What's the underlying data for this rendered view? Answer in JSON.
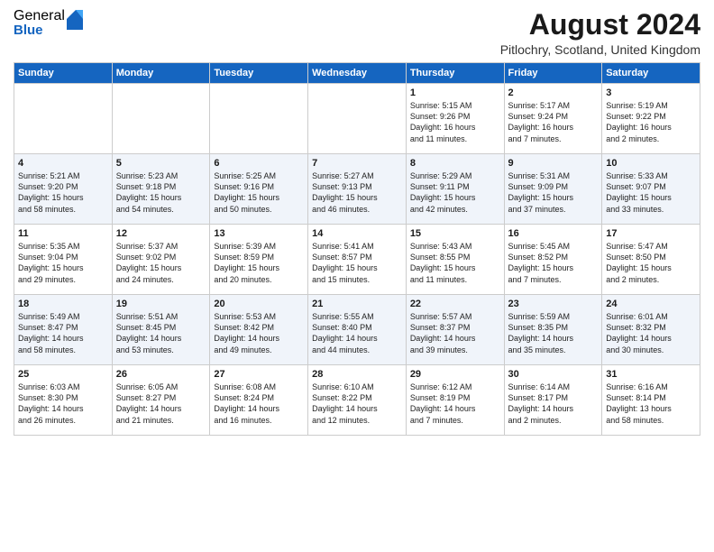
{
  "header": {
    "logo_general": "General",
    "logo_blue": "Blue",
    "month_title": "August 2024",
    "location": "Pitlochry, Scotland, United Kingdom"
  },
  "days_of_week": [
    "Sunday",
    "Monday",
    "Tuesday",
    "Wednesday",
    "Thursday",
    "Friday",
    "Saturday"
  ],
  "weeks": [
    [
      {
        "day": "",
        "info": ""
      },
      {
        "day": "",
        "info": ""
      },
      {
        "day": "",
        "info": ""
      },
      {
        "day": "",
        "info": ""
      },
      {
        "day": "1",
        "info": "Sunrise: 5:15 AM\nSunset: 9:26 PM\nDaylight: 16 hours\nand 11 minutes."
      },
      {
        "day": "2",
        "info": "Sunrise: 5:17 AM\nSunset: 9:24 PM\nDaylight: 16 hours\nand 7 minutes."
      },
      {
        "day": "3",
        "info": "Sunrise: 5:19 AM\nSunset: 9:22 PM\nDaylight: 16 hours\nand 2 minutes."
      }
    ],
    [
      {
        "day": "4",
        "info": "Sunrise: 5:21 AM\nSunset: 9:20 PM\nDaylight: 15 hours\nand 58 minutes."
      },
      {
        "day": "5",
        "info": "Sunrise: 5:23 AM\nSunset: 9:18 PM\nDaylight: 15 hours\nand 54 minutes."
      },
      {
        "day": "6",
        "info": "Sunrise: 5:25 AM\nSunset: 9:16 PM\nDaylight: 15 hours\nand 50 minutes."
      },
      {
        "day": "7",
        "info": "Sunrise: 5:27 AM\nSunset: 9:13 PM\nDaylight: 15 hours\nand 46 minutes."
      },
      {
        "day": "8",
        "info": "Sunrise: 5:29 AM\nSunset: 9:11 PM\nDaylight: 15 hours\nand 42 minutes."
      },
      {
        "day": "9",
        "info": "Sunrise: 5:31 AM\nSunset: 9:09 PM\nDaylight: 15 hours\nand 37 minutes."
      },
      {
        "day": "10",
        "info": "Sunrise: 5:33 AM\nSunset: 9:07 PM\nDaylight: 15 hours\nand 33 minutes."
      }
    ],
    [
      {
        "day": "11",
        "info": "Sunrise: 5:35 AM\nSunset: 9:04 PM\nDaylight: 15 hours\nand 29 minutes."
      },
      {
        "day": "12",
        "info": "Sunrise: 5:37 AM\nSunset: 9:02 PM\nDaylight: 15 hours\nand 24 minutes."
      },
      {
        "day": "13",
        "info": "Sunrise: 5:39 AM\nSunset: 8:59 PM\nDaylight: 15 hours\nand 20 minutes."
      },
      {
        "day": "14",
        "info": "Sunrise: 5:41 AM\nSunset: 8:57 PM\nDaylight: 15 hours\nand 15 minutes."
      },
      {
        "day": "15",
        "info": "Sunrise: 5:43 AM\nSunset: 8:55 PM\nDaylight: 15 hours\nand 11 minutes."
      },
      {
        "day": "16",
        "info": "Sunrise: 5:45 AM\nSunset: 8:52 PM\nDaylight: 15 hours\nand 7 minutes."
      },
      {
        "day": "17",
        "info": "Sunrise: 5:47 AM\nSunset: 8:50 PM\nDaylight: 15 hours\nand 2 minutes."
      }
    ],
    [
      {
        "day": "18",
        "info": "Sunrise: 5:49 AM\nSunset: 8:47 PM\nDaylight: 14 hours\nand 58 minutes."
      },
      {
        "day": "19",
        "info": "Sunrise: 5:51 AM\nSunset: 8:45 PM\nDaylight: 14 hours\nand 53 minutes."
      },
      {
        "day": "20",
        "info": "Sunrise: 5:53 AM\nSunset: 8:42 PM\nDaylight: 14 hours\nand 49 minutes."
      },
      {
        "day": "21",
        "info": "Sunrise: 5:55 AM\nSunset: 8:40 PM\nDaylight: 14 hours\nand 44 minutes."
      },
      {
        "day": "22",
        "info": "Sunrise: 5:57 AM\nSunset: 8:37 PM\nDaylight: 14 hours\nand 39 minutes."
      },
      {
        "day": "23",
        "info": "Sunrise: 5:59 AM\nSunset: 8:35 PM\nDaylight: 14 hours\nand 35 minutes."
      },
      {
        "day": "24",
        "info": "Sunrise: 6:01 AM\nSunset: 8:32 PM\nDaylight: 14 hours\nand 30 minutes."
      }
    ],
    [
      {
        "day": "25",
        "info": "Sunrise: 6:03 AM\nSunset: 8:30 PM\nDaylight: 14 hours\nand 26 minutes."
      },
      {
        "day": "26",
        "info": "Sunrise: 6:05 AM\nSunset: 8:27 PM\nDaylight: 14 hours\nand 21 minutes."
      },
      {
        "day": "27",
        "info": "Sunrise: 6:08 AM\nSunset: 8:24 PM\nDaylight: 14 hours\nand 16 minutes."
      },
      {
        "day": "28",
        "info": "Sunrise: 6:10 AM\nSunset: 8:22 PM\nDaylight: 14 hours\nand 12 minutes."
      },
      {
        "day": "29",
        "info": "Sunrise: 6:12 AM\nSunset: 8:19 PM\nDaylight: 14 hours\nand 7 minutes."
      },
      {
        "day": "30",
        "info": "Sunrise: 6:14 AM\nSunset: 8:17 PM\nDaylight: 14 hours\nand 2 minutes."
      },
      {
        "day": "31",
        "info": "Sunrise: 6:16 AM\nSunset: 8:14 PM\nDaylight: 13 hours\nand 58 minutes."
      }
    ]
  ]
}
